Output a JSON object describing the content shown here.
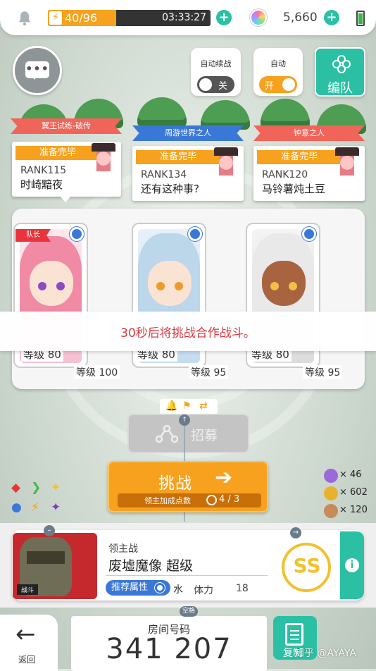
{
  "topbar": {
    "stamina": "40/96",
    "timer": "03:33:27",
    "stamina_fraction": 0.42,
    "gem_count": "5,660"
  },
  "toggles": {
    "auto_continue": {
      "label": "自动续战",
      "state": "关"
    },
    "auto": {
      "label": "自动",
      "state": "开"
    }
  },
  "formation_label": "编队",
  "players": [
    {
      "title": "翼王试练-破传",
      "status": "准备完毕",
      "rank": "RANK115",
      "name": "时崎黯夜",
      "title_color": "#f0645a"
    },
    {
      "title": "周游世界之人",
      "status": "准备完毕",
      "rank": "RANK134",
      "name": "还有这种事?",
      "title_color": "#3a78d8"
    },
    {
      "title": "钟意之人",
      "status": "准备完毕",
      "rank": "RANK120",
      "name": "马铃薯炖土豆",
      "title_color": "#f0645a"
    }
  ],
  "party": {
    "leader_tag": "队长",
    "members": [
      {
        "level": "等级 80",
        "sub_level": "等级 100",
        "hair": "#f08aa5",
        "eye": "#8a4cc0"
      },
      {
        "level": "等级 80",
        "sub_level": "等级 95",
        "hair": "#bcd6ea",
        "eye": "#f09a2a"
      },
      {
        "level": "等级 80",
        "sub_level": "等级 95",
        "hair": "#e9e9ea",
        "eye": "#d8583a"
      }
    ]
  },
  "notice": "30秒后将挑战合作战斗。",
  "recruit_label": "招募",
  "challenge": {
    "label": "挑战",
    "sub_label": "领主加成点数",
    "count": "4 / 3"
  },
  "resources": [
    {
      "value": "× 46",
      "color": "#9b6ad8"
    },
    {
      "value": "× 602",
      "color": "#e9b22c"
    },
    {
      "value": "× 120",
      "color": "#c98a5a"
    }
  ],
  "boss": {
    "context": "领主战",
    "name": "废墟魔像 超级",
    "image_tag": "战斗",
    "attr_label": "推荐属性",
    "attr_value": "水",
    "stamina_label": "体力",
    "stamina_value": "18",
    "grade": "SS"
  },
  "bottom": {
    "back_label": "返回",
    "space_label": "空格",
    "room_label": "房间号码",
    "room_number": "341 207",
    "copy_label": "复制",
    "watermark": "知乎 @AYAYA"
  }
}
